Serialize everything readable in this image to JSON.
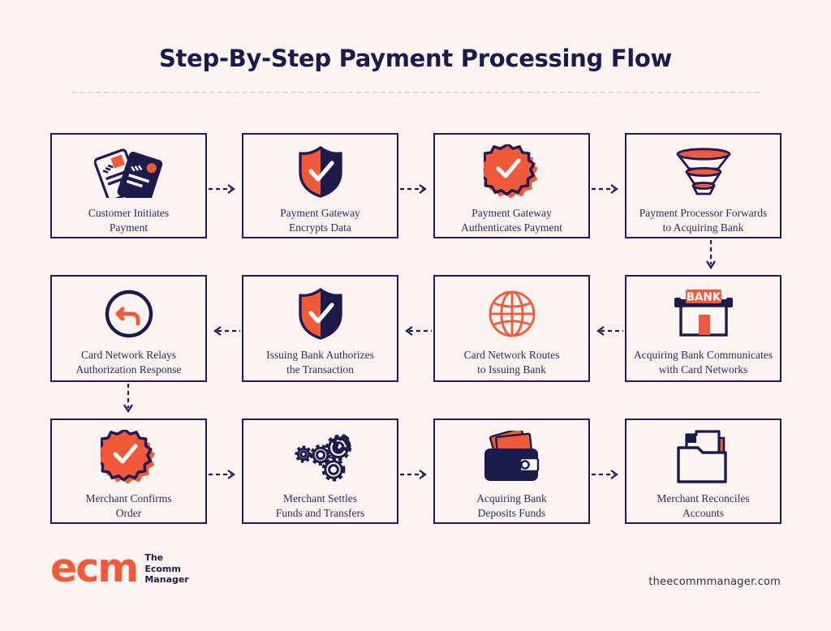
{
  "header": {
    "title": "Step-By-Step Payment Processing Flow"
  },
  "colors": {
    "background": "#fdf3f0",
    "navy": "#211a53",
    "navy_dark": "#1b1b4b",
    "orange": "#f05a38",
    "text": "#2b2b5e",
    "divider": "#e3d3d3"
  },
  "flow": {
    "rows": [
      {
        "direction": "left-to-right",
        "steps": [
          {
            "index": 1,
            "icon": "credit-cards-icon",
            "line1": "Customer Initiates",
            "line2": "Payment"
          },
          {
            "index": 2,
            "icon": "shield-check-icon",
            "line1": "Payment Gateway",
            "line2": "Encrypts Data"
          },
          {
            "index": 3,
            "icon": "badge-check-icon",
            "line1": "Payment Gateway",
            "line2": "Authenticates Payment"
          },
          {
            "index": 4,
            "icon": "funnel-icon",
            "line1": "Payment Processor Forwards",
            "line2": "to Acquiring Bank"
          }
        ]
      },
      {
        "direction": "right-to-left",
        "steps": [
          {
            "index": 8,
            "icon": "return-arrow-icon",
            "line1": "Card Network Relays",
            "line2": "Authorization Response"
          },
          {
            "index": 7,
            "icon": "shield-check-icon",
            "line1": "Issuing Bank Authorizes",
            "line2": "the Transaction"
          },
          {
            "index": 6,
            "icon": "globe-icon",
            "line1": "Card Network Routes",
            "line2": "to Issuing Bank"
          },
          {
            "index": 5,
            "icon": "bank-building-icon",
            "line1": "Acquiring Bank Communicates",
            "line2": "with Card Networks"
          }
        ]
      },
      {
        "direction": "left-to-right",
        "steps": [
          {
            "index": 9,
            "icon": "badge-check-icon",
            "line1": "Merchant Confirms",
            "line2": "Order"
          },
          {
            "index": 10,
            "icon": "gears-icon",
            "line1": "Merchant Settles",
            "line2": "Funds and Transfers"
          },
          {
            "index": 11,
            "icon": "wallet-icon",
            "line1": "Acquiring Bank",
            "line2": "Deposits Funds"
          },
          {
            "index": 12,
            "icon": "folder-documents-icon",
            "line1": "Merchant Reconciles",
            "line2": "Accounts"
          }
        ]
      }
    ],
    "connectors": {
      "row1_to_row2": "dashed-arrow-down-right-column",
      "row2_to_row3": "dashed-arrow-down-left-column",
      "horizontal": "dashed-arrow"
    }
  },
  "footer": {
    "logo_mark": "ecm",
    "logo_line1": "The",
    "logo_line2": "Ecomm",
    "logo_line3": "Manager",
    "url": "theecommmanager.com"
  }
}
